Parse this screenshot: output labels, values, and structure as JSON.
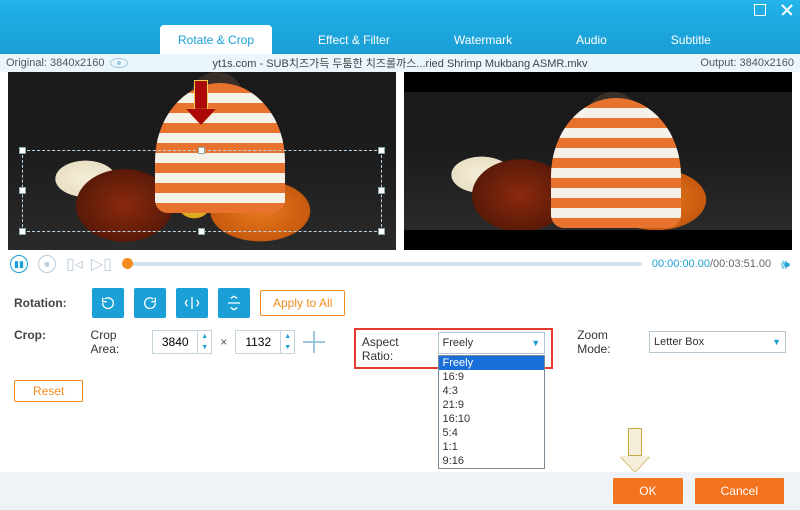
{
  "window": {
    "maximize_title": "Maximize",
    "close_title": "Close"
  },
  "tabs": {
    "rotate_crop": "Rotate & Crop",
    "effect_filter": "Effect & Filter",
    "watermark": "Watermark",
    "audio": "Audio",
    "subtitle": "Subtitle"
  },
  "info": {
    "original_label": "Original: 3840x2160",
    "file_title": "yt1s.com - SUB치즈가득 두툼한 치즈롤까스...ried Shrimp Mukbang ASMR.mkv",
    "output_label": "Output: 3840x2160"
  },
  "playback": {
    "current": "00:00:00.00",
    "sep": "/",
    "duration": "00:03:51.00"
  },
  "rotation": {
    "label": "Rotation:",
    "apply_all": "Apply to All"
  },
  "crop": {
    "label": "Crop:",
    "area_label": "Crop Area:",
    "width": "3840",
    "height": "1132",
    "reset": "Reset"
  },
  "aspect": {
    "label": "Aspect Ratio:",
    "selected": "Freely",
    "options": [
      "Freely",
      "16:9",
      "4:3",
      "21:9",
      "16:10",
      "5:4",
      "1:1",
      "9:16"
    ]
  },
  "zoom": {
    "label": "Zoom Mode:",
    "selected": "Letter Box"
  },
  "footer": {
    "ok": "OK",
    "cancel": "Cancel"
  }
}
